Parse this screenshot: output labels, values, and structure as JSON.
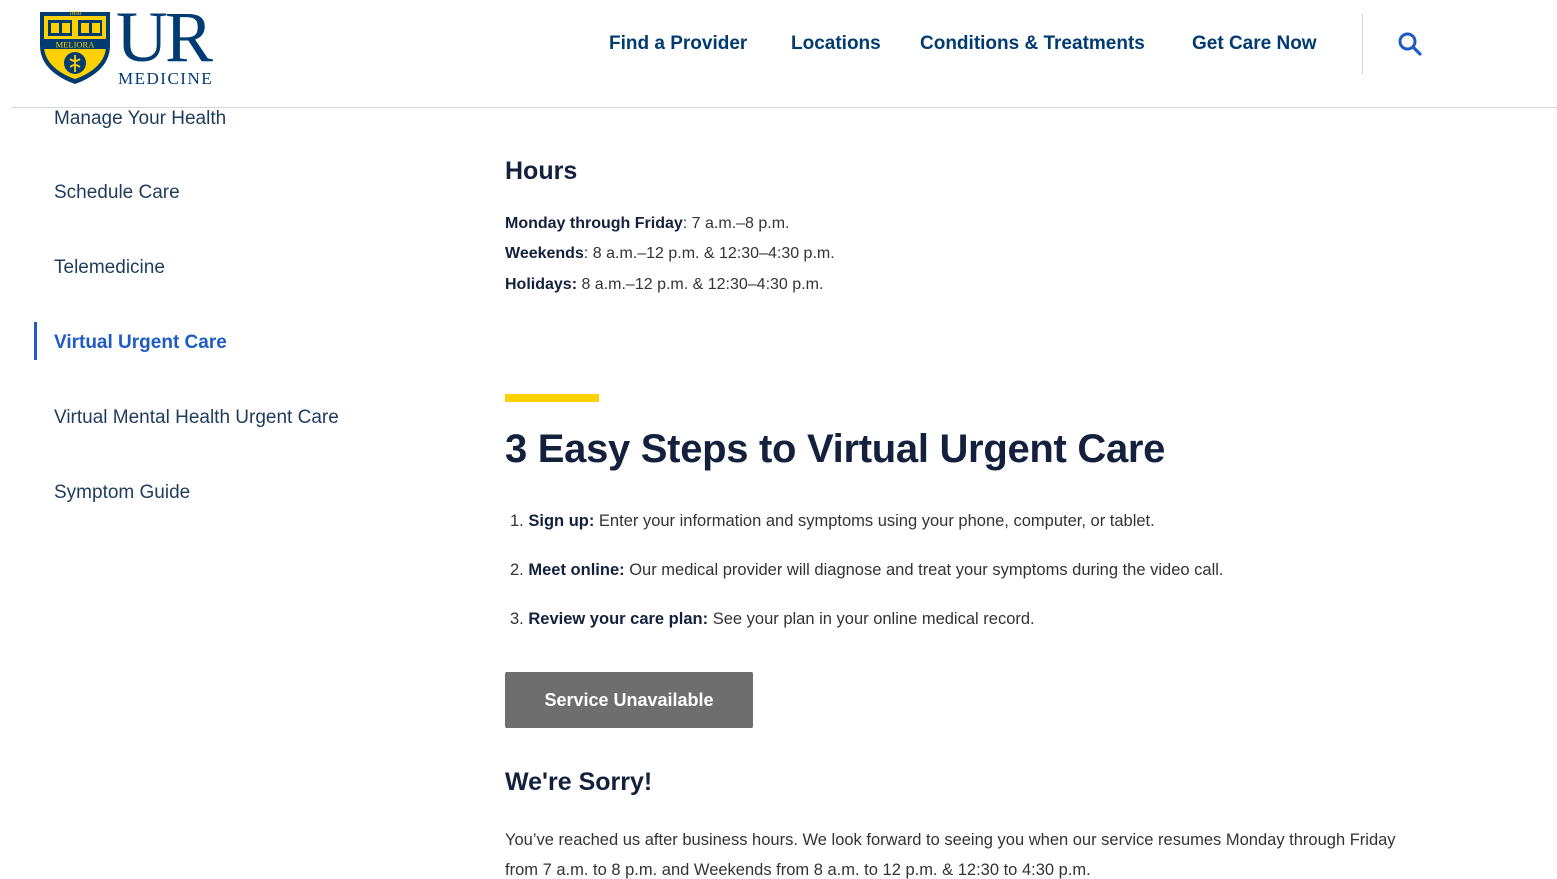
{
  "header": {
    "logo": {
      "ur": "UR",
      "medicine": "MEDICINE",
      "shield_year": "1850",
      "shield_motto": "MELIORA"
    },
    "nav": [
      "Find a Provider",
      "Locations",
      "Conditions & Treatments",
      "Get Care Now"
    ],
    "search_icon": "search-icon",
    "brand_color": "#003b71"
  },
  "sidebar": {
    "items": [
      {
        "label": "Manage Your Health",
        "active": false
      },
      {
        "label": "Schedule Care",
        "active": false
      },
      {
        "label": "Telemedicine",
        "active": false
      },
      {
        "label": "Virtual Urgent Care",
        "active": true
      },
      {
        "label": "Virtual Mental Health Urgent Care",
        "active": false
      },
      {
        "label": "Symptom Guide",
        "active": false
      }
    ],
    "active_color": "#1f5bc4"
  },
  "hours": {
    "heading": "Hours",
    "lines": [
      {
        "label": "Monday through Friday",
        "value": ": 7 a.m.–8 p.m."
      },
      {
        "label": "Weekends",
        "value": ": 8 a.m.–12 p.m. & 12:30–4:30 p.m."
      },
      {
        "label": "Holidays:",
        "value": " 8 a.m.–12 p.m. & 12:30–4:30 p.m."
      }
    ]
  },
  "steps": {
    "heading": "3 Easy Steps to Virtual Urgent Care",
    "accent_color": "#ffd100",
    "items": [
      {
        "num": "1. ",
        "label": "Sign up:",
        "text": " Enter your information and symptoms using your phone, computer, or tablet."
      },
      {
        "num": "2. ",
        "label": "Meet online:",
        "text": " Our medical provider will diagnose and treat your symptoms during the video call."
      },
      {
        "num": "3. ",
        "label": "Review your care plan:",
        "text": " See your plan in your online medical record."
      }
    ]
  },
  "service_button": {
    "label": "Service Unavailable",
    "color": "#6e6e6e"
  },
  "sorry": {
    "heading": "We're Sorry!",
    "text": "You’ve reached us after business hours. We look forward to seeing you when our service resumes Monday through Friday from 7 a.m. to 8 p.m. and Weekends from 8 a.m. to 12 p.m. & 12:30 to 4:30 p.m."
  }
}
